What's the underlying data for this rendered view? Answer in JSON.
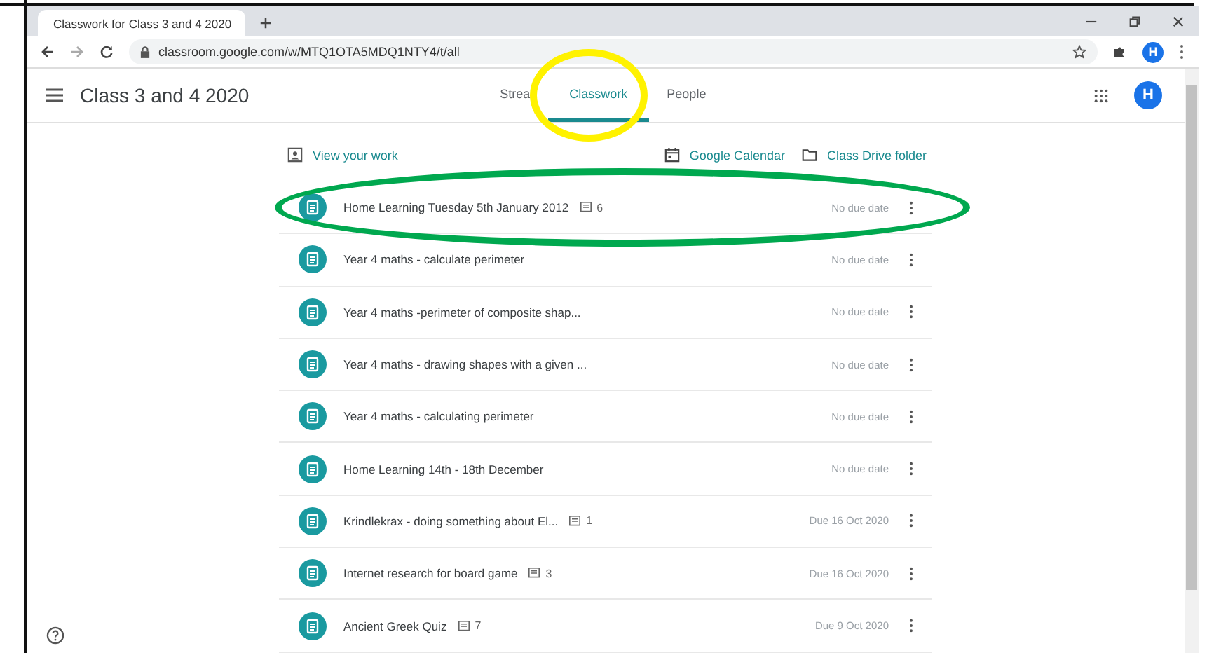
{
  "browser": {
    "tab_title": "Classwork for Class 3 and 4 2020",
    "url": "classroom.google.com/w/MTQ1OTA5MDQ1NTY4/t/all",
    "profile_initial": "H"
  },
  "header": {
    "course_title": "Class 3 and 4 2020",
    "avatar_initial": "H"
  },
  "nav_tabs": [
    {
      "label": "Strea",
      "selected": false
    },
    {
      "label": "Classwork",
      "selected": true
    },
    {
      "label": "People",
      "selected": false
    }
  ],
  "links": {
    "view_work": "View your work",
    "calendar": "Google Calendar",
    "drive": "Class Drive folder"
  },
  "assignments": [
    {
      "title": "Home Learning Tuesday 5th January 2012",
      "comments": "6",
      "due": "No due date"
    },
    {
      "title": "Year 4 maths - calculate perimeter",
      "due": "No due date"
    },
    {
      "title": "Year 4 maths -perimeter of composite shap...",
      "due": "No due date"
    },
    {
      "title": "Year 4 maths - drawing shapes with a given ...",
      "due": "No due date"
    },
    {
      "title": "Year 4 maths - calculating perimeter",
      "due": "No due date"
    },
    {
      "title": "Home Learning 14th - 18th December",
      "due": "No due date"
    },
    {
      "title": "Krindlekrax - doing something about El...",
      "comments": "1",
      "due": "Due 16 Oct 2020"
    },
    {
      "title": "Internet research for board game",
      "comments": "3",
      "due": "Due 16 Oct 2020"
    },
    {
      "title": "Ancient Greek Quiz",
      "comments": "7",
      "due": "Due 9 Oct 2020"
    }
  ],
  "annotations": [
    {
      "kind": "ellipse",
      "color": "#fff200"
    },
    {
      "kind": "ellipse",
      "color": "#00a84f"
    }
  ]
}
